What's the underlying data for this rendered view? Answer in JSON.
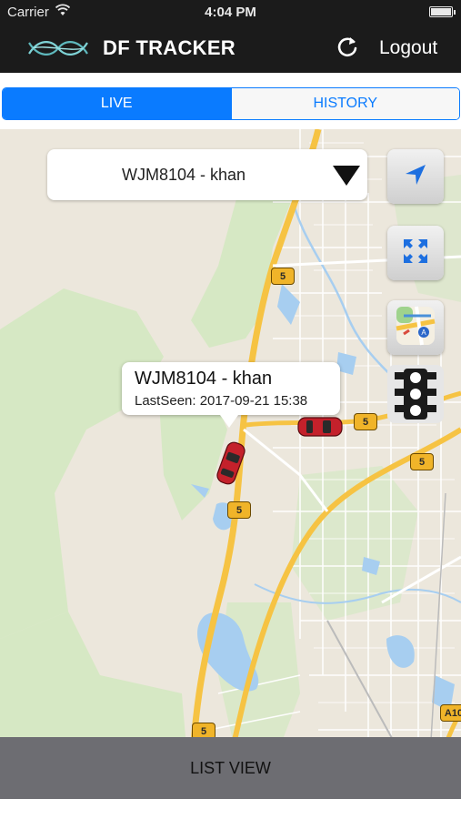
{
  "status_bar": {
    "carrier": "Carrier",
    "time": "4:04 PM"
  },
  "nav_bar": {
    "title": "DF TRACKER",
    "logout_label": "Logout"
  },
  "tabs": [
    {
      "label": "LIVE",
      "active": true
    },
    {
      "label": "HISTORY",
      "active": false
    }
  ],
  "vehicle_picker": {
    "selected": "WJM8104 - khan"
  },
  "callout": {
    "title": "WJM8104 - khan",
    "last_seen": "LastSeen: 2017-09-21 15:38"
  },
  "map": {
    "route_labels": [
      "5",
      "5",
      "5",
      "5",
      "5",
      "5",
      "A10"
    ],
    "colors": {
      "land": "#ece7dc",
      "park": "#d6e8c4",
      "water": "#a7cef0",
      "highway": "#f6c343",
      "road": "#ffffff",
      "accent": "#0a7bff"
    }
  },
  "map_controls": [
    {
      "name": "locate",
      "icon": "location-arrow-icon"
    },
    {
      "name": "fit",
      "icon": "expand-icon"
    },
    {
      "name": "map-type",
      "icon": "map-icon"
    },
    {
      "name": "traffic",
      "icon": "traffic-light-icon"
    }
  ],
  "footer": {
    "list_view_label": "LIST VIEW"
  }
}
